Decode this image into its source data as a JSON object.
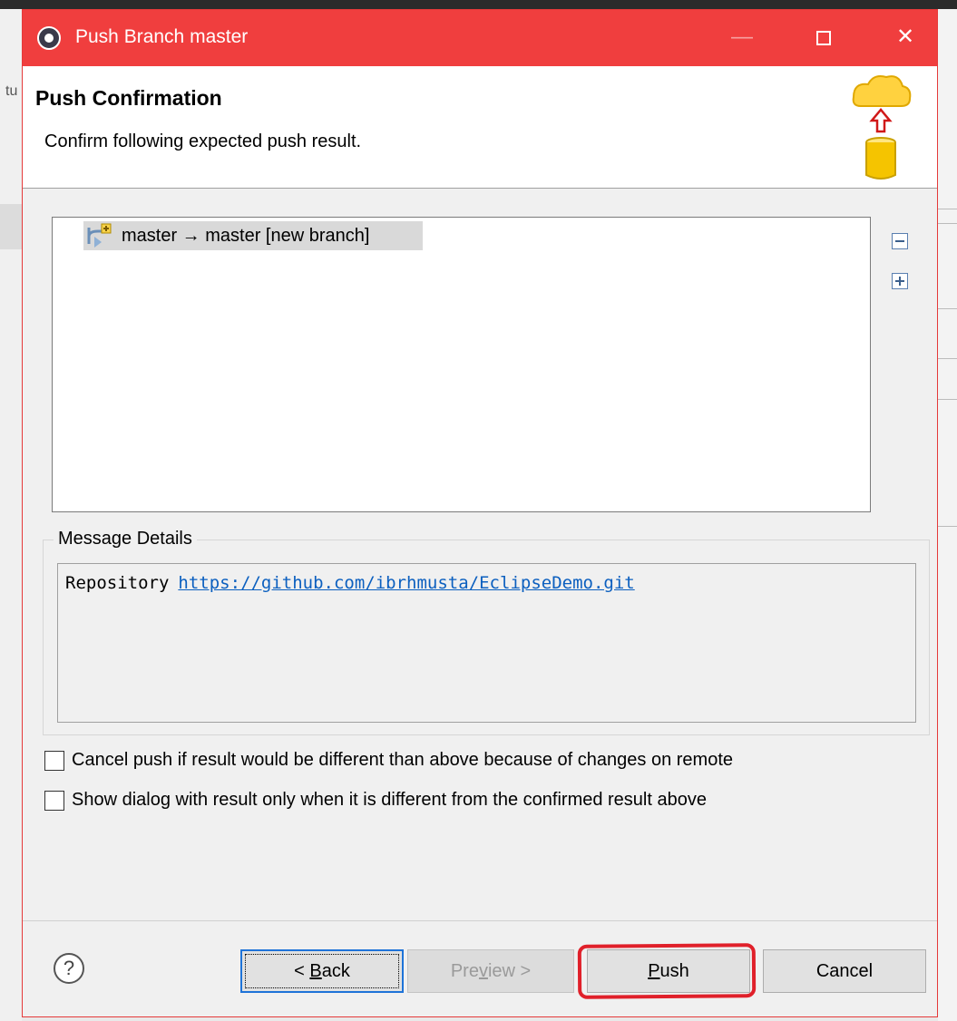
{
  "window": {
    "title": "Push Branch master"
  },
  "header": {
    "title": "Push Confirmation",
    "description": "Confirm following expected push result."
  },
  "tree": {
    "items": [
      {
        "label": "master → master [new branch]"
      }
    ]
  },
  "message_details": {
    "group_label": "Message Details",
    "repository_label": "Repository",
    "repository_url": "https://github.com/ibrhmusta/EclipseDemo.git"
  },
  "options": {
    "cancel_if_different": {
      "label": "Cancel push if result would be different than above because of changes on remote",
      "checked": false
    },
    "show_only_when_different": {
      "label": "Show dialog with result only when it is different from the confirmed result above",
      "checked": false
    }
  },
  "buttons": {
    "back_prefix": "< ",
    "back_mnemonic": "B",
    "back_rest": "ack",
    "preview_start": "Pre",
    "preview_mnemonic": "v",
    "preview_rest": "iew >",
    "push_mnemonic": "P",
    "push_rest": "ush",
    "cancel": "Cancel",
    "help": "?"
  },
  "background": {
    "left_fragment": "tu"
  },
  "colors": {
    "titlebar": "#f03e3e",
    "link": "#0b5fbf",
    "highlight": "#e0202a"
  }
}
